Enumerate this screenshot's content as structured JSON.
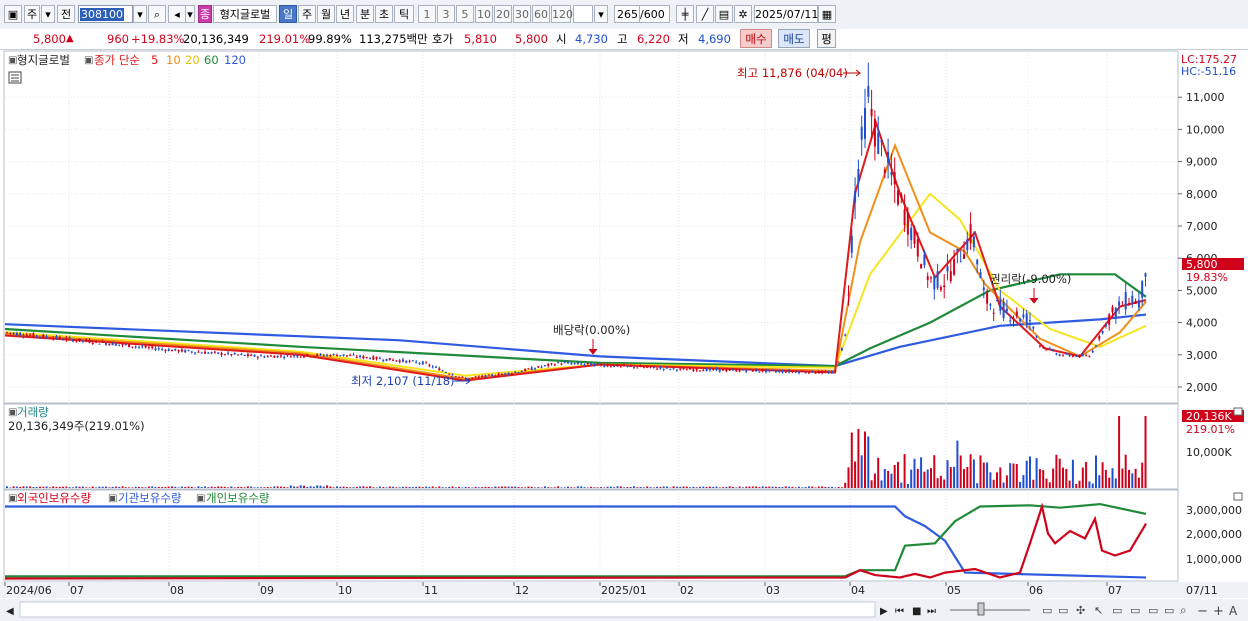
{
  "toolbar": {
    "mode_label": "주",
    "prev_label": "전",
    "stock_code": "308100",
    "stock_name_badge": "종",
    "stock_name": "형지글로벌",
    "periods": [
      "일",
      "주",
      "월",
      "년",
      "분",
      "초",
      "틱"
    ],
    "selected_period": "일",
    "intervals": [
      "1",
      "3",
      "5",
      "10",
      "20",
      "30",
      "60",
      "120"
    ],
    "count_value": "265",
    "count_total": "/600",
    "date_value": "2025/07/11"
  },
  "quote": {
    "price": "5,800",
    "change_arrow": "▲",
    "change": "960",
    "change_pct": "+19.83%",
    "volume": "20,136,349",
    "volume_ratio": "219.01%",
    "strength": "99.89%",
    "amount": "113,275백만",
    "hoga_label": "호가",
    "ask": "5,810",
    "bid": "5,800",
    "open_label": "시",
    "open": "4,730",
    "high_label": "고",
    "high": "6,220",
    "low_label": "저",
    "low": "4,690",
    "buy_button": "매수",
    "sell_button": "매도",
    "eval_button": "평"
  },
  "price_panel": {
    "legend_name": "형지글로벌",
    "legend_ma_label": "종가 단순",
    "ma_periods": [
      "5",
      "10",
      "20",
      "60",
      "120"
    ],
    "ma_colors": [
      "#e01b1b",
      "#f0901a",
      "#f5e51e",
      "#1f8a3a",
      "#2f5be0"
    ],
    "lc_label": "LC:175.27",
    "hc_label": "HC:-51.16",
    "high_annotation": "최고 11,876 (04/04)",
    "low_annotation": "최저 2,107 (11/18)",
    "dividend_annotation": "배당락(0.00%)",
    "rights_annotation": "권리락(-9.00%)",
    "price_tag": "5,800",
    "pct_tag": "19.83%",
    "y_ticks": [
      "11,000",
      "10,000",
      "9,000",
      "8,000",
      "7,000",
      "6,000",
      "5,000",
      "4,000",
      "3,000",
      "2,000"
    ]
  },
  "volume_panel": {
    "title": "거래량",
    "value_label": "20,136,349주(219.01%)",
    "tag": "20,136K",
    "tag_pct": "219.01%",
    "y_tick": "10,000K"
  },
  "holdings_panel": {
    "legend": [
      "외국인보유수량",
      "기관보유수량",
      "개인보유수량"
    ],
    "legend_colors": [
      "#d0021b",
      "#2f5be0",
      "#1f8a3a"
    ],
    "y_ticks": [
      "3,000,000",
      "2,000,000",
      "1,000,000"
    ]
  },
  "x_axis": {
    "labels": [
      "2024/06",
      "07",
      "08",
      "09",
      "10",
      "11",
      "12",
      "2025/01",
      "02",
      "03",
      "04",
      "05",
      "06",
      "07"
    ],
    "right_label": "07/11"
  }
}
